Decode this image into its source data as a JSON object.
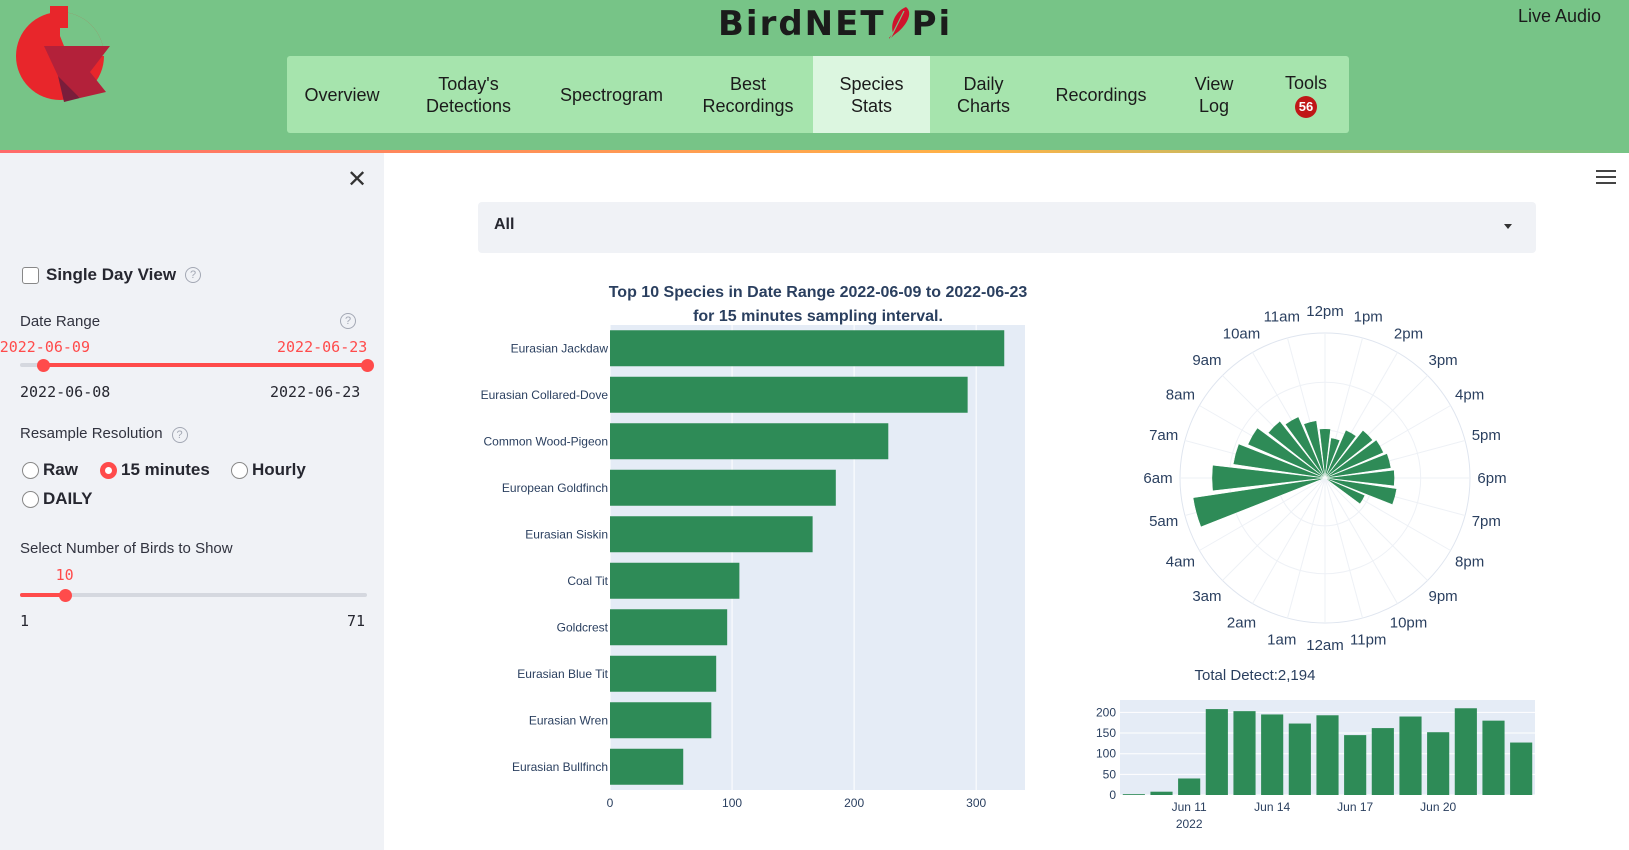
{
  "header": {
    "app_title_left": "BirdNET",
    "app_title_right": "Pi",
    "live_audio": "Live Audio",
    "nav": [
      {
        "label": "Overview",
        "width": 110
      },
      {
        "label": "Today's Detections",
        "width": 143
      },
      {
        "label": "Spectrogram",
        "width": 143
      },
      {
        "label": "Best Recordings",
        "width": 130
      },
      {
        "label": "Species Stats",
        "width": 117,
        "active": true
      },
      {
        "label": "Daily Charts",
        "width": 107
      },
      {
        "label": "Recordings",
        "width": 128
      },
      {
        "label": "View Log",
        "width": 98
      },
      {
        "label": "Tools",
        "width": 86,
        "badge": "56"
      }
    ]
  },
  "sidebar": {
    "single_day_view": "Single Day View",
    "help": "?",
    "date_range_label": "Date Range",
    "date_start_selected": "2022-06-09",
    "date_end_selected": "2022-06-23",
    "date_min": "2022-06-08",
    "date_max": "2022-06-23",
    "date_start_fraction": 0.0667,
    "date_end_fraction": 1.0,
    "resample_label": "Resample Resolution",
    "resample_options": [
      "Raw",
      "15 minutes",
      "Hourly",
      "DAILY"
    ],
    "resample_selected": "15 minutes",
    "birds_label": "Select Number of Birds to Show",
    "birds_value": "10",
    "birds_min": "1",
    "birds_max": "71",
    "birds_fraction": 0.1286
  },
  "main": {
    "species_select": "All",
    "total_detect": "Total Detect:2,194"
  },
  "chart_data": [
    {
      "type": "bar",
      "orientation": "horizontal",
      "title": "Top 10 Species in Date Range 2022-06-09 to 2022-06-23",
      "subtitle": "for 15 minutes sampling interval.",
      "categories": [
        "Eurasian Jackdaw",
        "Eurasian Collared-Dove",
        "Common Wood-Pigeon",
        "European Goldfinch",
        "Eurasian Siskin",
        "Coal Tit",
        "Goldcrest",
        "Eurasian Blue Tit",
        "Eurasian Wren",
        "Eurasian Bullfinch"
      ],
      "values": [
        323,
        293,
        228,
        185,
        166,
        106,
        96,
        87,
        83,
        60
      ],
      "xlim": [
        0,
        340
      ],
      "xticks": [
        0,
        100,
        200,
        300
      ],
      "color": "#2e8b57"
    },
    {
      "type": "polar_bar",
      "angular_labels": [
        "12am",
        "1am",
        "2am",
        "3am",
        "4am",
        "5am",
        "6am",
        "7am",
        "8am",
        "9am",
        "10am",
        "11am",
        "12pm",
        "1pm",
        "2pm",
        "3pm",
        "4pm",
        "5pm",
        "6pm",
        "7pm",
        "8pm",
        "9pm",
        "10pm",
        "11pm"
      ],
      "direction": "clockwise",
      "rotation": "12pm at top",
      "values": [
        0,
        0,
        0,
        0,
        0,
        0.92,
        0.78,
        0.64,
        0.58,
        0.5,
        0.46,
        0.4,
        0.34,
        0.28,
        0.36,
        0.42,
        0.44,
        0.46,
        0.48,
        0.5,
        0.3,
        0,
        0,
        0
      ],
      "rmax": 1.0,
      "color": "#2e8b57"
    },
    {
      "type": "bar",
      "title": "Total Detect:2,194",
      "x": [
        "2022-06-09",
        "2022-06-10",
        "2022-06-11",
        "2022-06-12",
        "2022-06-13",
        "2022-06-14",
        "2022-06-15",
        "2022-06-16",
        "2022-06-17",
        "2022-06-18",
        "2022-06-19",
        "2022-06-20",
        "2022-06-21",
        "2022-06-22",
        "2022-06-23"
      ],
      "values": [
        2,
        8,
        40,
        208,
        203,
        195,
        173,
        193,
        145,
        162,
        190,
        152,
        210,
        180,
        127
      ],
      "ylim": [
        0,
        230
      ],
      "yticks": [
        0,
        50,
        100,
        150,
        200
      ],
      "xtick_labels": [
        {
          "date": "2022-06-11",
          "label": "Jun 11"
        },
        {
          "date": "2022-06-14",
          "label": "Jun 14"
        },
        {
          "date": "2022-06-17",
          "label": "Jun 17"
        },
        {
          "date": "2022-06-20",
          "label": "Jun 20"
        }
      ],
      "year_label": "2022",
      "color": "#2e8b57"
    }
  ]
}
